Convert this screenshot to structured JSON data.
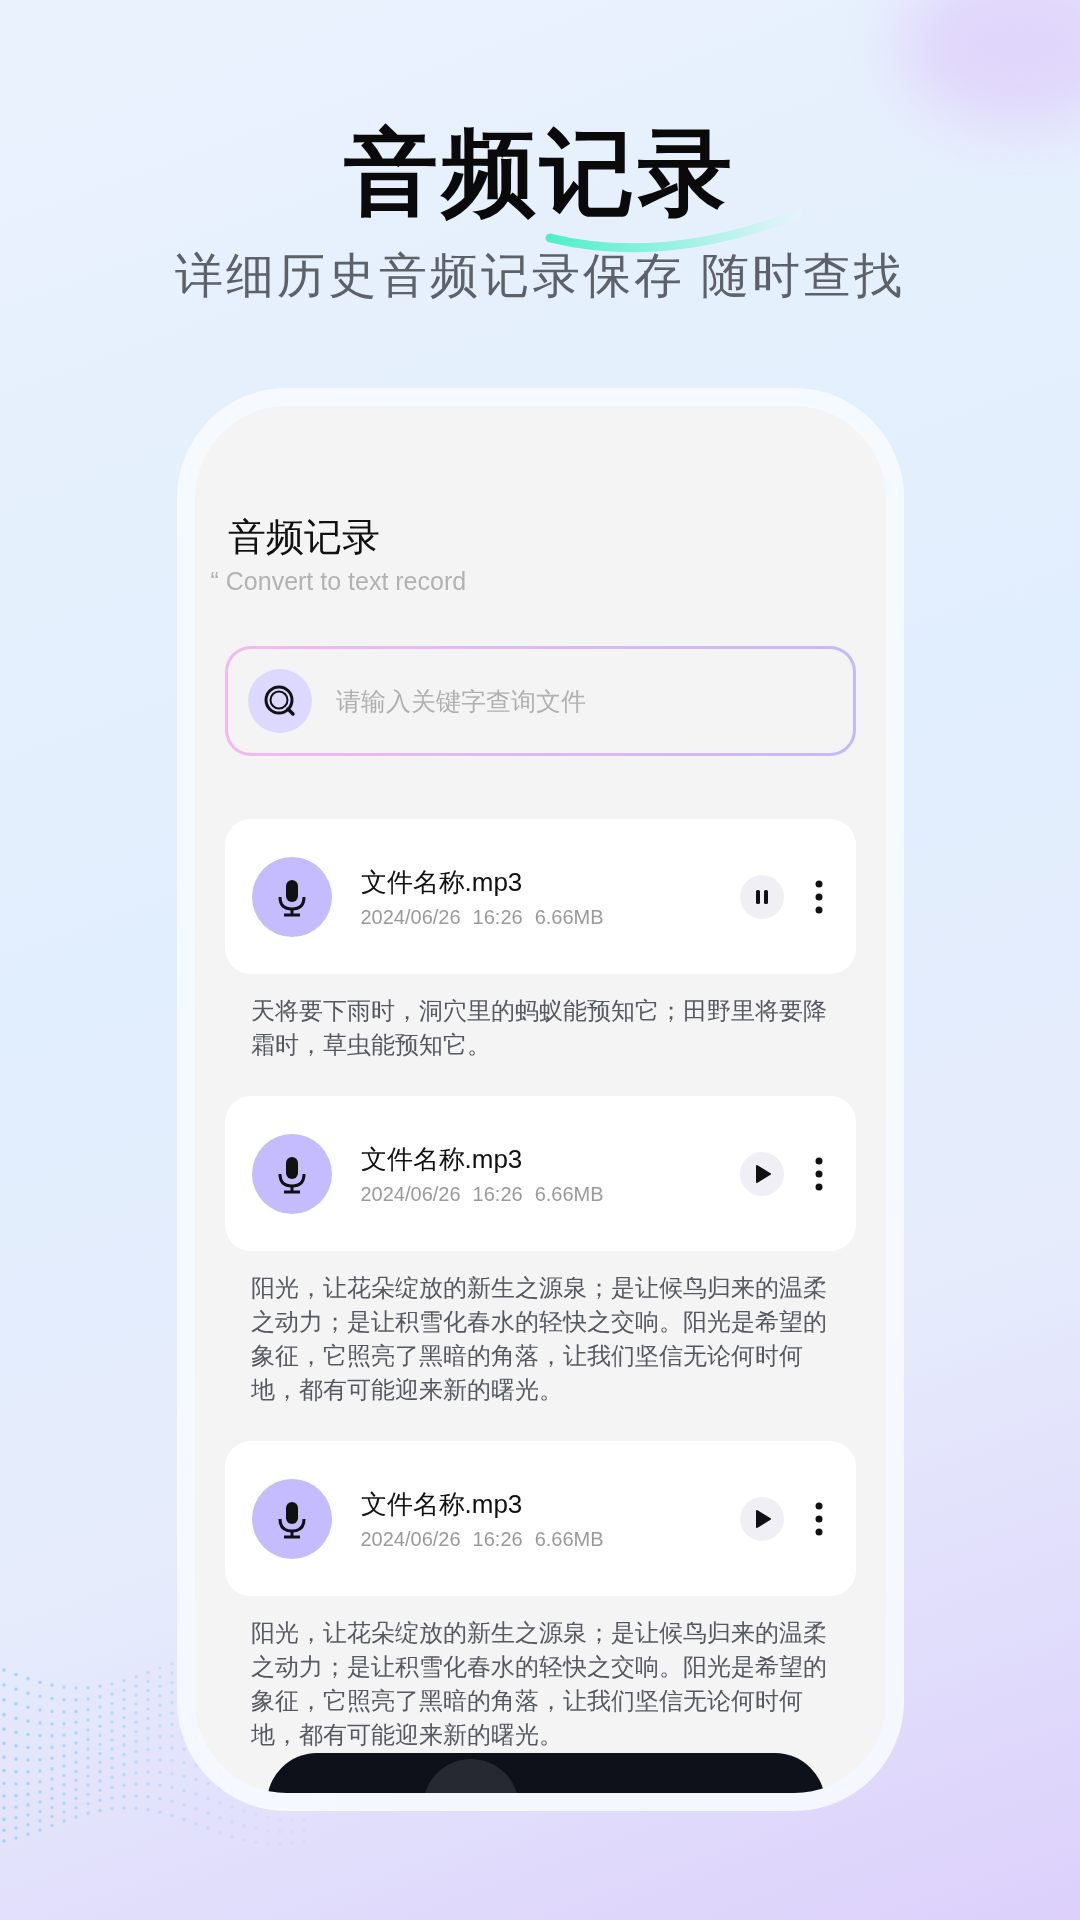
{
  "headline": "音频记录",
  "tagline": "详细历史音频记录保存 随时查找",
  "screen": {
    "title": "音频记录",
    "subtitle": "“ Convert to text record",
    "search": {
      "placeholder": "请输入关键字查询文件"
    },
    "records": [
      {
        "name": "文件名称.mp3",
        "date": "2024/06/26",
        "time": "16:26",
        "size": "6.66MB",
        "playing": true,
        "text": "天将要下雨时，洞穴里的蚂蚁能预知它；田野里将要降霜时，草虫能预知它。"
      },
      {
        "name": "文件名称.mp3",
        "date": "2024/06/26",
        "time": "16:26",
        "size": "6.66MB",
        "playing": false,
        "text": "阳光，让花朵绽放的新生之源泉；是让候鸟归来的温柔之动力；是让积雪化春水的轻快之交响。阳光是希望的象征，它照亮了黑暗的角落，让我们坚信无论何时何地，都有可能迎来新的曙光。"
      },
      {
        "name": "文件名称.mp3",
        "date": "2024/06/26",
        "time": "16:26",
        "size": "6.66MB",
        "playing": false,
        "text": "阳光，让花朵绽放的新生之源泉；是让候鸟归来的温柔之动力；是让积雪化春水的轻快之交响。阳光是希望的象征，它照亮了黑暗的角落，让我们坚信无论何时何地，都有可能迎来新的曙光。"
      }
    ]
  }
}
